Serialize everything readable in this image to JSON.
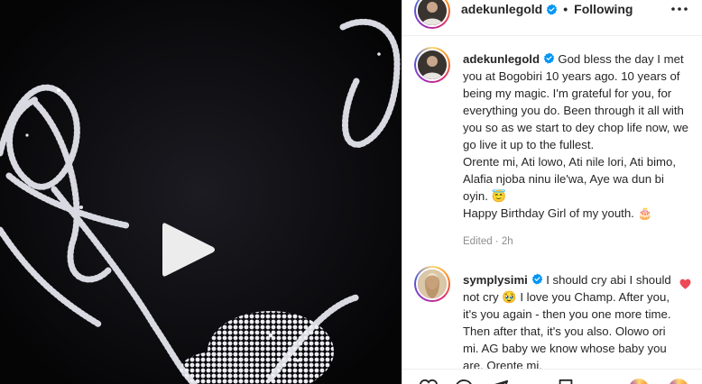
{
  "media": {
    "play_icon": "play-icon"
  },
  "post": {
    "username": "adekunlegold",
    "separator": "•",
    "follow_status": "Following",
    "more_icon": "more-options-icon"
  },
  "caption": {
    "username": "adekunlegold",
    "lines": [
      "God bless the day I met you at Bogobiri 10 years ago. 10 years of being my magic. I'm grateful for you, for everything you do. Been through it all with you so as we start to dey chop life now, we go live it up to the fullest.",
      "Orente mi, Ati lowo, Ati nile lori, Ati bimo, Alafia njoba ninu ile'wa, Aye wa dun bi oyin. 😇",
      "Happy Birthday Girl of my youth. 🎂"
    ],
    "meta": "Edited · 2h"
  },
  "comment": {
    "username": "symplysimi",
    "text": "I should cry abi I should not cry 🥹 I love you Champ. After you, it's you again - then you one more time. Then after that, it's you also. Olowo ori mi. AG baby we know whose baby you are. Orente mi.",
    "like_icon": "heart-icon",
    "like_color": "#ed4956"
  },
  "colors": {
    "verified": "#0095f6",
    "muted": "#8e8e8e"
  }
}
